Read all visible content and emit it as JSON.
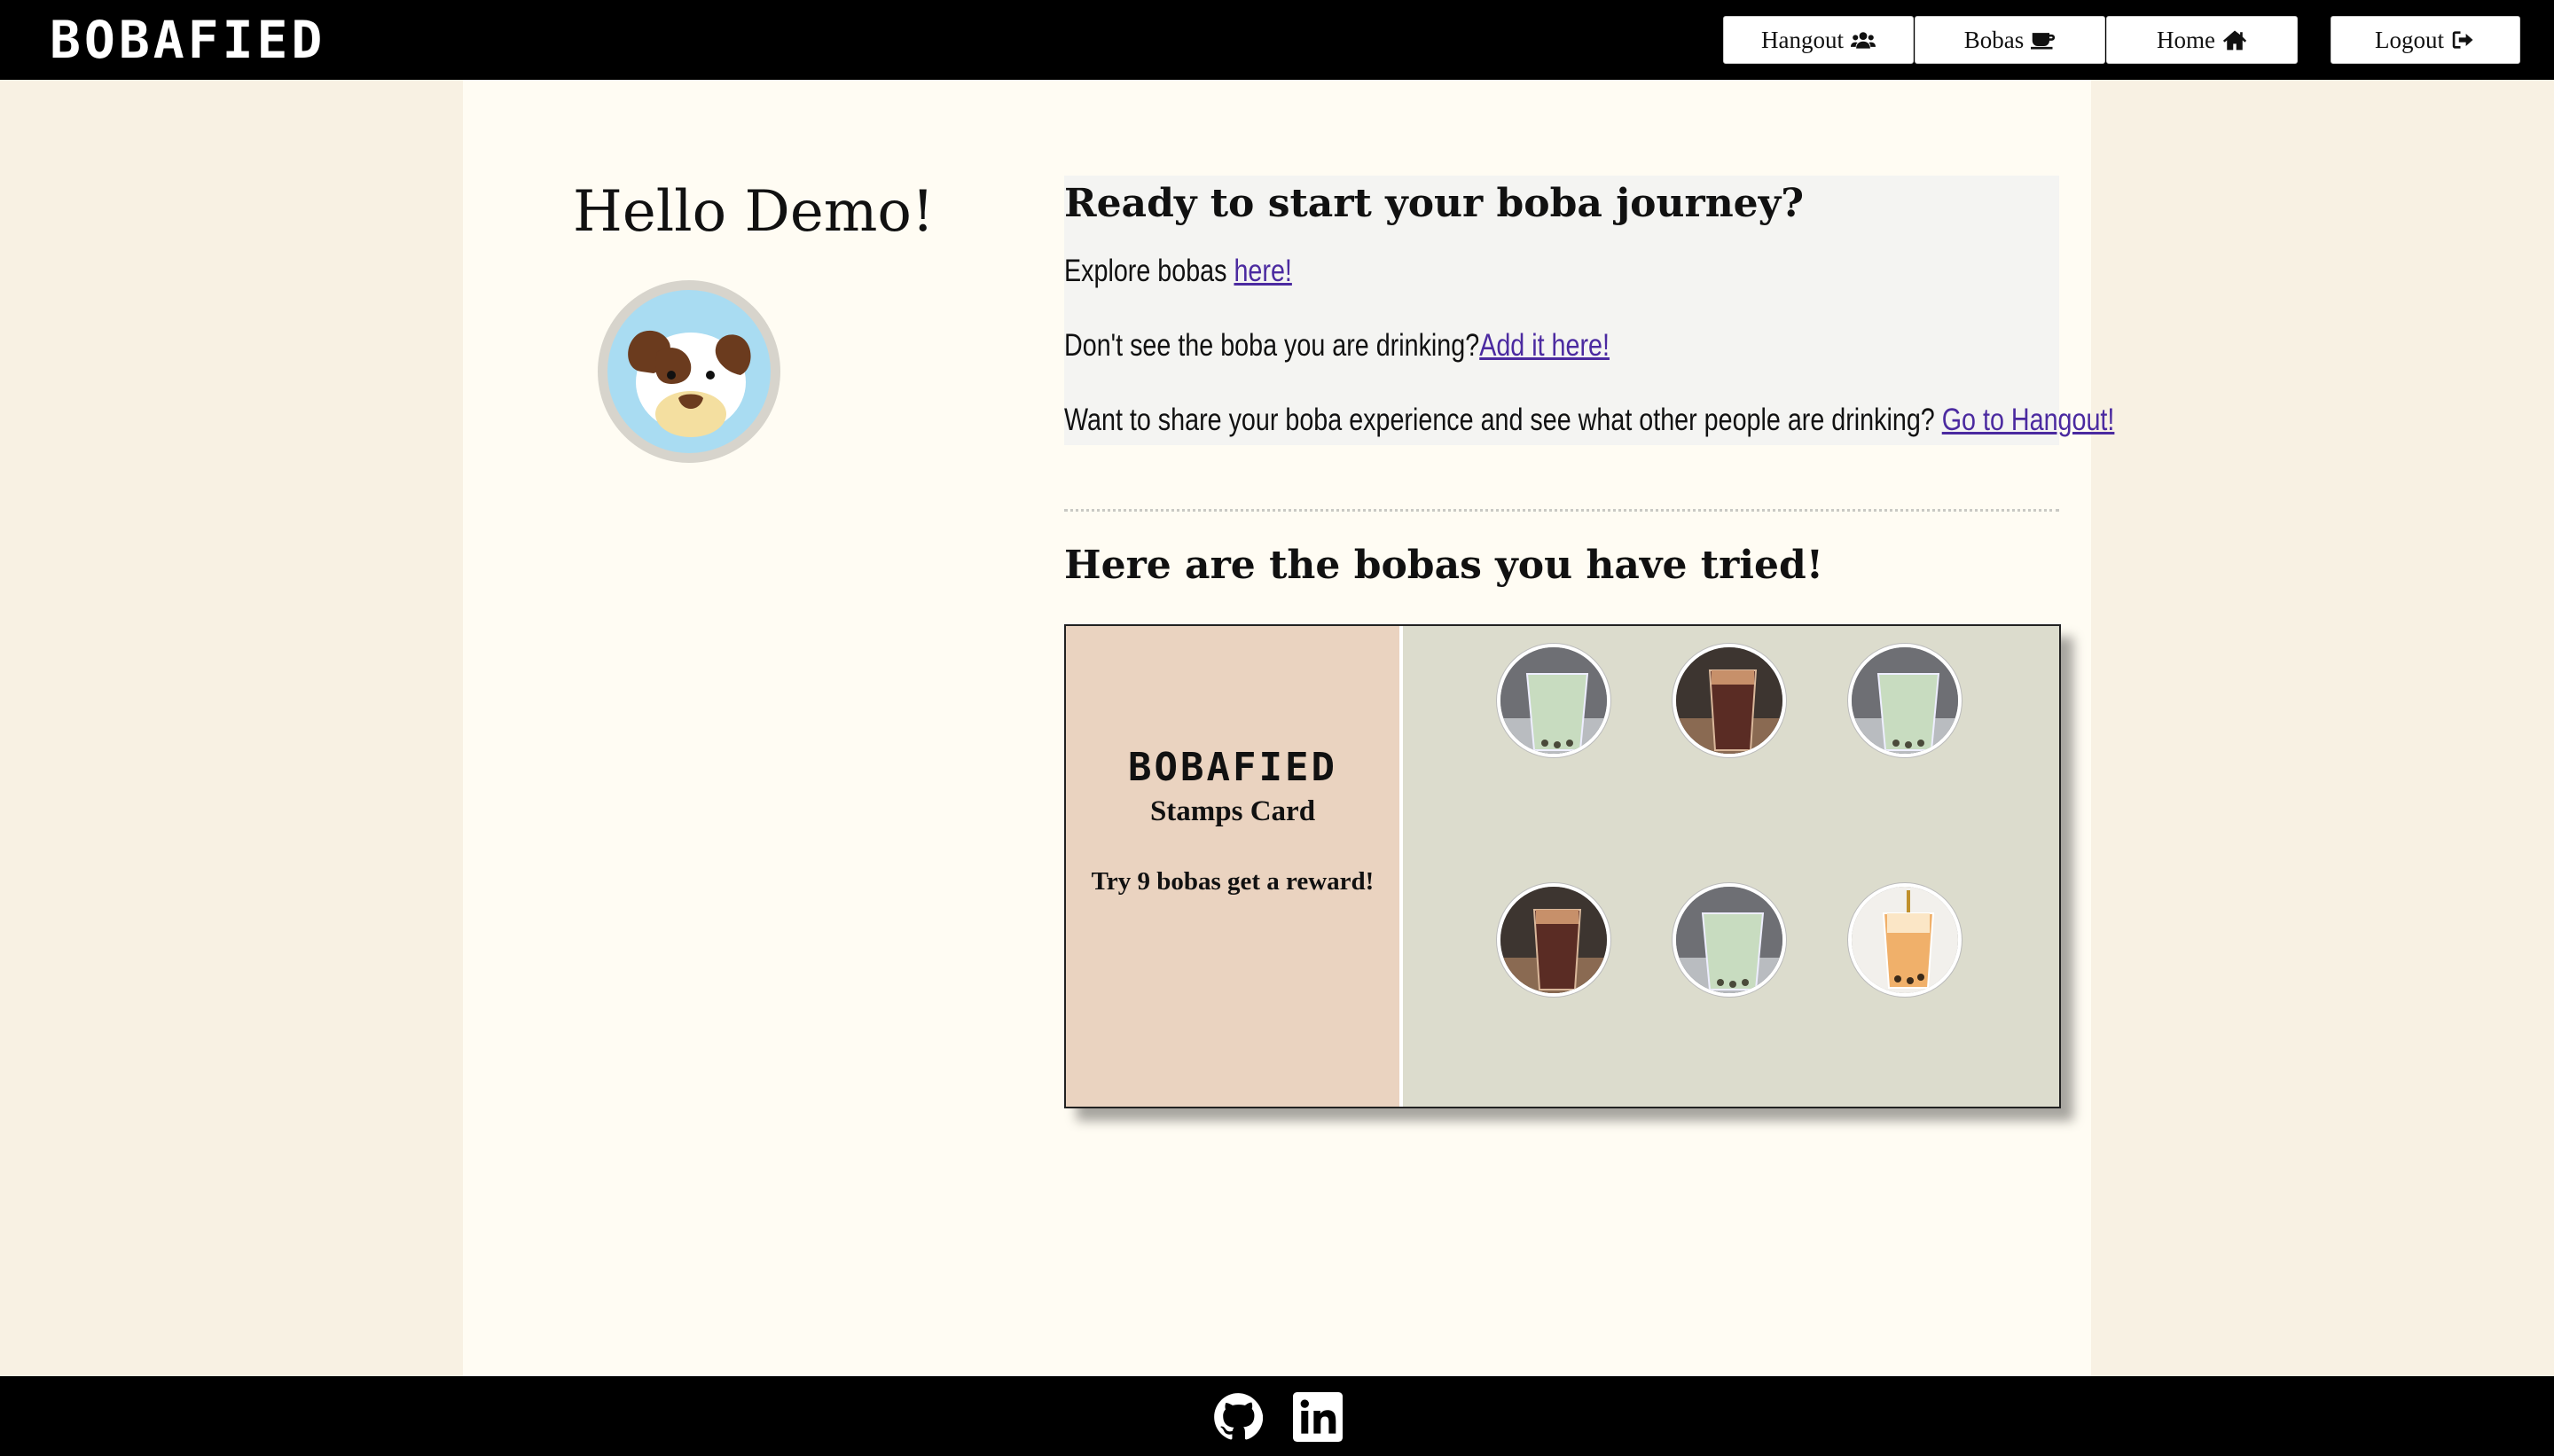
{
  "header": {
    "logo": "BOBAFIED",
    "nav": [
      {
        "label": "Hangout",
        "icon": "users-icon"
      },
      {
        "label": "Bobas",
        "icon": "coffee-icon"
      },
      {
        "label": "Home",
        "icon": "home-icon"
      },
      {
        "label": "Logout",
        "icon": "sign-out-icon"
      }
    ]
  },
  "profile": {
    "greeting": "Hello Demo!",
    "avatar": "dog-avatar-icon"
  },
  "intro": {
    "heading": "Ready to start your boba journey?",
    "explore_text": "Explore bobas ",
    "explore_link": "here!",
    "add_text": "Don't see the boba you are drinking?",
    "add_link": "Add it here!",
    "share_text": "Want to share your boba experience and see what other people are drinking? ",
    "share_link": "Go to Hangout!"
  },
  "tried": {
    "heading": "Here are the bobas you have tried!"
  },
  "stamp_card": {
    "logo": "BOBAFIED",
    "title": "Stamps Card",
    "subtitle": "Try 9 bobas get a reward!",
    "stamps": [
      {
        "kind": "matcha-boba"
      },
      {
        "kind": "brown-sugar-boba"
      },
      {
        "kind": "matcha-boba"
      },
      {
        "kind": "brown-sugar-boba"
      },
      {
        "kind": "matcha-boba"
      },
      {
        "kind": "thai-tea-boba"
      }
    ]
  },
  "footer": {
    "icons": [
      "github-icon",
      "linkedin-icon"
    ]
  },
  "colors": {
    "page_bg": "#f8f1e3",
    "panel_bg": "#fffcf3",
    "link": "#4b2aa0",
    "card_left": "#ead3c0",
    "card_right": "#dcdccd"
  }
}
